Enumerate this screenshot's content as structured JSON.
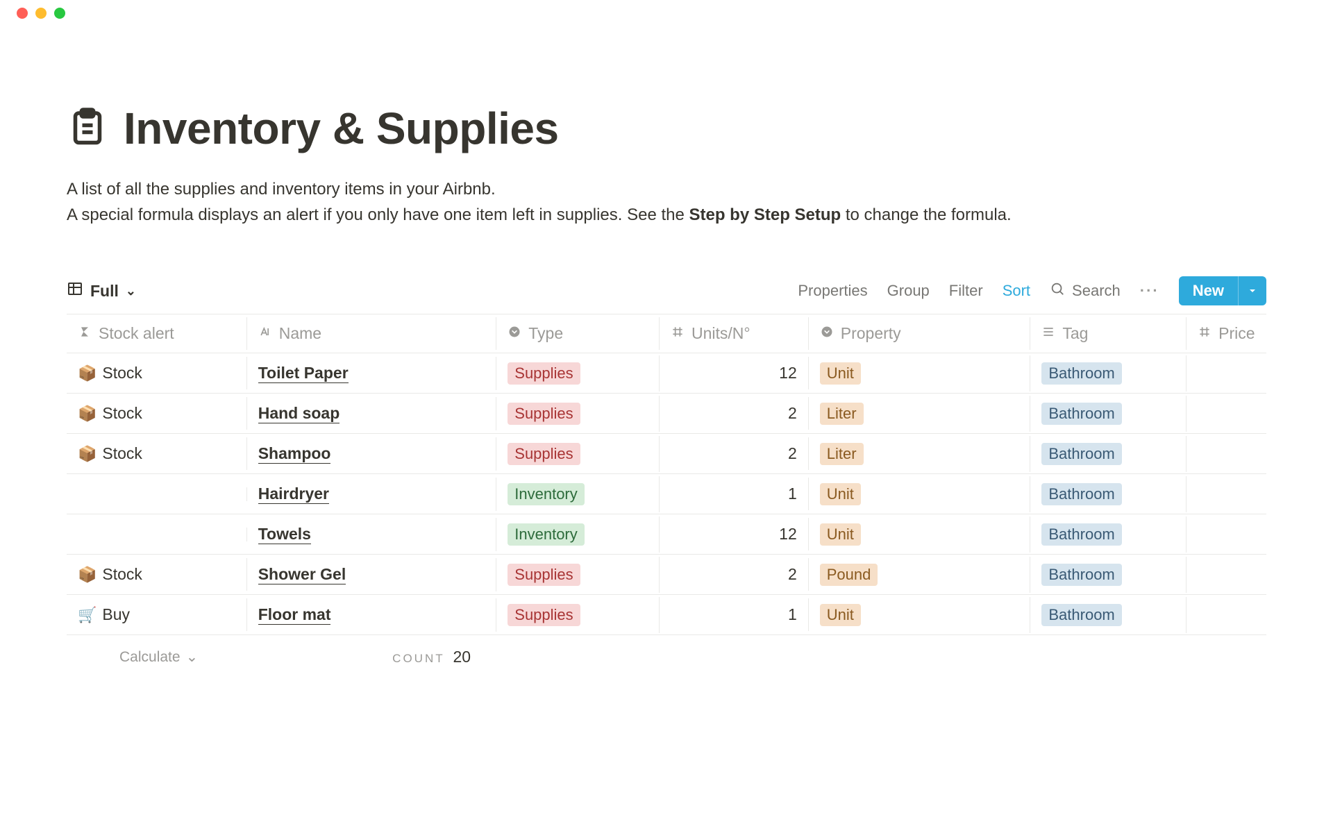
{
  "page": {
    "title": "Inventory & Supplies",
    "desc_line1": "A list of all the supplies and inventory items in your Airbnb.",
    "desc_line2a": "A special formula displays an alert if you only have one item left in supplies. See the ",
    "desc_bold": "Step by Step Setup",
    "desc_line2b": " to change the formula."
  },
  "view": {
    "name": "Full",
    "controls": {
      "properties": "Properties",
      "group": "Group",
      "filter": "Filter",
      "sort": "Sort",
      "search": "Search",
      "new": "New"
    }
  },
  "columns": {
    "alert": "Stock alert",
    "name": "Name",
    "type": "Type",
    "units": "Units/N°",
    "property": "Property",
    "tag": "Tag",
    "price": "Price"
  },
  "rows": [
    {
      "alert_icon": "📦",
      "alert": "Stock",
      "name": "Toilet Paper",
      "type": "Supplies",
      "units": "12",
      "property": "Unit",
      "tag": "Bathroom"
    },
    {
      "alert_icon": "📦",
      "alert": "Stock",
      "name": "Hand soap",
      "type": "Supplies",
      "units": "2",
      "property": "Liter",
      "tag": "Bathroom"
    },
    {
      "alert_icon": "📦",
      "alert": "Stock",
      "name": "Shampoo",
      "type": "Supplies",
      "units": "2",
      "property": "Liter",
      "tag": "Bathroom"
    },
    {
      "alert_icon": "",
      "alert": "",
      "name": "Hairdryer",
      "type": "Inventory",
      "units": "1",
      "property": "Unit",
      "tag": "Bathroom"
    },
    {
      "alert_icon": "",
      "alert": "",
      "name": "Towels",
      "type": "Inventory",
      "units": "12",
      "property": "Unit",
      "tag": "Bathroom"
    },
    {
      "alert_icon": "📦",
      "alert": "Stock",
      "name": "Shower Gel",
      "type": "Supplies",
      "units": "2",
      "property": "Pound",
      "tag": "Bathroom"
    },
    {
      "alert_icon": "🛒",
      "alert": "Buy",
      "name": "Floor mat",
      "type": "Supplies",
      "units": "1",
      "property": "Unit",
      "tag": "Bathroom"
    }
  ],
  "footer": {
    "calculate": "Calculate",
    "count_label": "COUNT",
    "count_value": "20"
  }
}
